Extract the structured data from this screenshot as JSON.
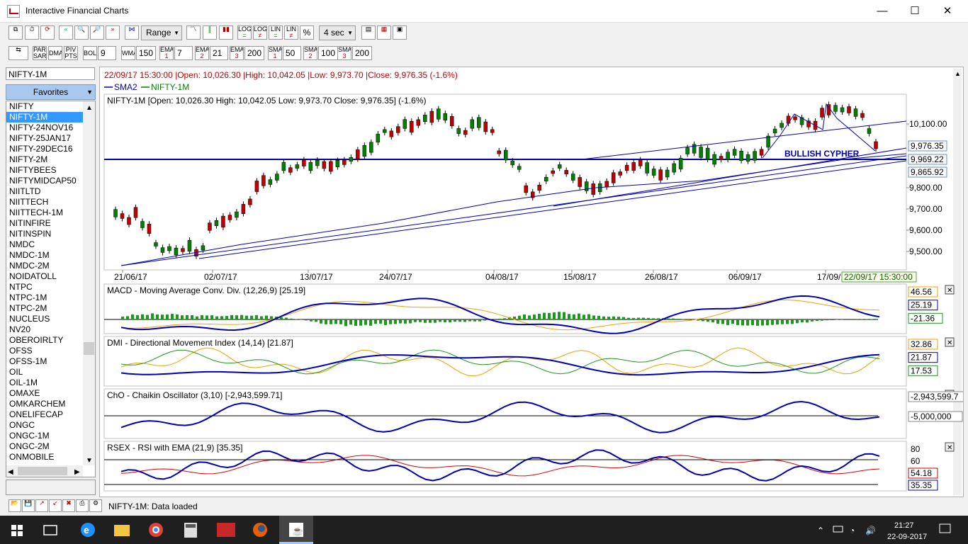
{
  "window": {
    "title": "Interactive Financial Charts",
    "min": "—",
    "max": "☐",
    "close": "✕"
  },
  "toolbar1": {
    "range_label": "Range",
    "interval_label": "4 sec",
    "log1": "LOG",
    "log2": "LOG",
    "lin1": "LIN",
    "lin2": "LIN",
    "pct": "%"
  },
  "toolbar2": {
    "par_sar": "PAR SAR",
    "dma": "DMA",
    "piv_pts": "PIV PTS",
    "bol_label": "BOL",
    "bol_value": "9",
    "wma_label": "WMA",
    "wma_value": "150",
    "ema1_label": "EMA",
    "ema1_idx": "1",
    "ema1_value": "7",
    "ema2_label": "EMA",
    "ema2_idx": "2",
    "ema2_value": "21",
    "ema3_label": "EMA",
    "ema3_idx": "3",
    "ema3_value": "200",
    "sma1_label": "SMA",
    "sma1_idx": "1",
    "sma1_value": "50",
    "sma2_label": "SMA",
    "sma2_idx": "2",
    "sma2_value": "100",
    "sma3_label": "SMA",
    "sma3_idx": "3",
    "sma3_value": "200"
  },
  "sidebar": {
    "symbol": "NIFTY-1M",
    "favorites_label": "Favorites",
    "items": [
      "NIFTY",
      "NIFTY-1M",
      "NIFTY-24NOV16",
      "NIFTY-25JAN17",
      "NIFTY-29DEC16",
      "NIFTY-2M",
      "NIFTYBEES",
      "NIFTYMIDCAP50",
      "NIITLTD",
      "NIITTECH",
      "NIITTECH-1M",
      "NITINFIRE",
      "NITINSPIN",
      "NMDC",
      "NMDC-1M",
      "NMDC-2M",
      "NOIDATOLL",
      "NTPC",
      "NTPC-1M",
      "NTPC-2M",
      "NUCLEUS",
      "NV20",
      "OBEROIRLTY",
      "OFSS",
      "OFSS-1M",
      "OIL",
      "OIL-1M",
      "OMAXE",
      "OMKARCHEM",
      "ONELIFECAP",
      "ONGC",
      "ONGC-1M",
      "ONGC-2M",
      "ONMOBILE"
    ],
    "selected_index": 1
  },
  "chart": {
    "header": "22/09/17 15:30:00 |Open: 10,026.30 |High: 10,042.05 |Low: 9,973.70 |Close: 9,976.35 (-1.6%)",
    "legend_sma2": "SMA2",
    "legend_symbol": "NIFTY-1M",
    "price_panel_title": "NIFTY-1M [Open: 10,026.30  High: 10,042.05  Low: 9,973.70  Close: 9,976.35] (-1.6%)",
    "annotation": "BULLISH CYPHER",
    "price_axis": [
      "10,100.00",
      "9,800.00",
      "9,700.00",
      "9,600.00",
      "9,500.00"
    ],
    "price_tags": [
      "9,976.35",
      "9,969.22",
      "9,865.92"
    ],
    "date_labels": [
      "21/06/17",
      "02/07/17",
      "13/07/17",
      "24/07/17",
      "04/08/17",
      "15/08/17",
      "26/08/17",
      "06/09/17",
      "17/09/17"
    ],
    "cursor_date": "22/09/17 15:30:00",
    "colors": {
      "up": "#008000",
      "down": "#c00000",
      "line": "#0000b0",
      "grid": "#cccccc"
    }
  },
  "indicators": {
    "macd": {
      "title": "MACD - Moving Average Conv. Div. (12,26,9) [25.19]",
      "tags": [
        "46.56",
        "25.19",
        "-21.36"
      ]
    },
    "dmi": {
      "title": "DMI - Directional Movement Index (14,14) [21.87]",
      "tags": [
        "32.86",
        "21.87",
        "17.53"
      ]
    },
    "cho": {
      "title": "ChO - Chaikin Oscillator (3,10) [-2,943,599.71]",
      "tags": [
        "-2,943,599.7",
        "-5,000,000"
      ]
    },
    "rsi": {
      "title": "RSEX - RSI with EMA (21,9) [35.35]",
      "tags": [
        "80",
        "60",
        "54.18",
        "35.35"
      ]
    }
  },
  "status": {
    "message": "NIFTY-1M: Data loaded"
  },
  "taskbar": {
    "time": "21:27",
    "date": "22-09-2017"
  }
}
